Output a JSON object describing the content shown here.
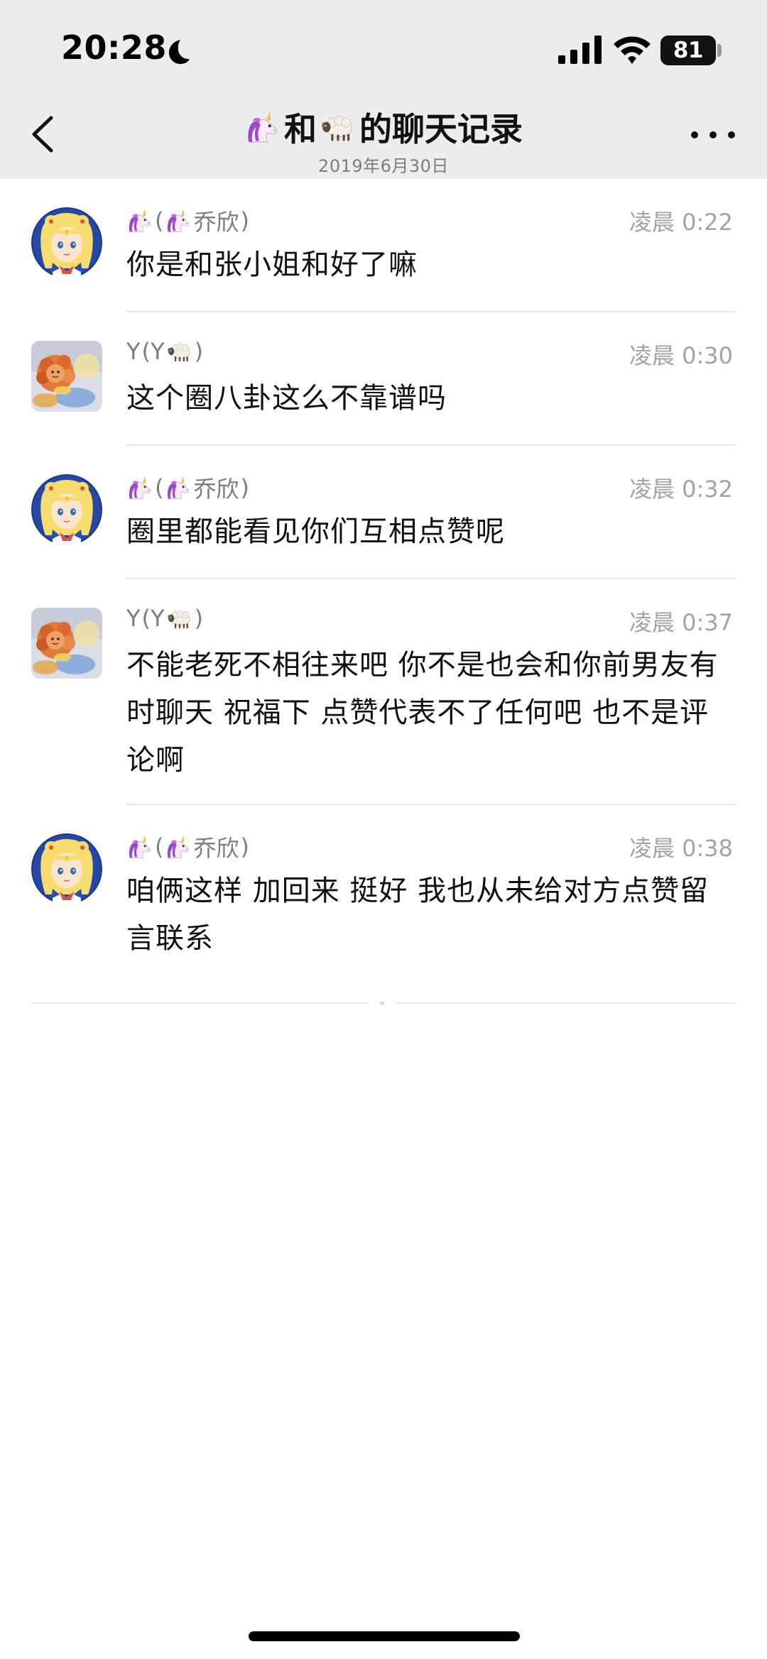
{
  "status_bar": {
    "time": "20:28",
    "battery": "81",
    "icons": [
      "moon-icon",
      "signal-icon",
      "wifi-icon",
      "battery-icon"
    ]
  },
  "header": {
    "title_connector": "和",
    "title_suffix": "的聊天记录",
    "title_left_emoji": "unicorn-emoji",
    "title_right_emoji": "sheep-emoji",
    "date": "2019年6月30日",
    "back_icon": "chevron-left-icon",
    "more_icon": "more-dots-icon"
  },
  "messages": [
    {
      "sender_open": "(",
      "sender_name": "乔欣",
      "sender_close": ")",
      "sender_kind": "unicorn",
      "time": "凌晨 0:22",
      "text": "你是和张小姐和好了嘛"
    },
    {
      "sender_prefix": "Y",
      "sender_open": " (Y",
      "sender_close": ")",
      "sender_kind": "sheep",
      "time": "凌晨 0:30",
      "text": "这个圈八卦这么不靠谱吗"
    },
    {
      "sender_open": "(",
      "sender_name": "乔欣",
      "sender_close": ")",
      "sender_kind": "unicorn",
      "time": "凌晨 0:32",
      "text": "圈里都能看见你们互相点赞呢"
    },
    {
      "sender_prefix": "Y",
      "sender_open": " (Y",
      "sender_close": ")",
      "sender_kind": "sheep",
      "time": "凌晨 0:37",
      "text": "不能老死不相往来吧 你不是也会和你前男友有时聊天 祝福下 点赞代表不了任何吧 也不是评论啊"
    },
    {
      "sender_open": "(",
      "sender_name": "乔欣",
      "sender_close": ")",
      "sender_kind": "unicorn",
      "time": "凌晨 0:38",
      "text": "咱俩这样 加回来 挺好  我也从未给对方点赞留言联系"
    }
  ],
  "colors": {
    "header_bg": "#ededed",
    "secondary_text": "#7d7d7d",
    "time_text": "#a3a3a3",
    "divider": "#e7e7e7"
  }
}
